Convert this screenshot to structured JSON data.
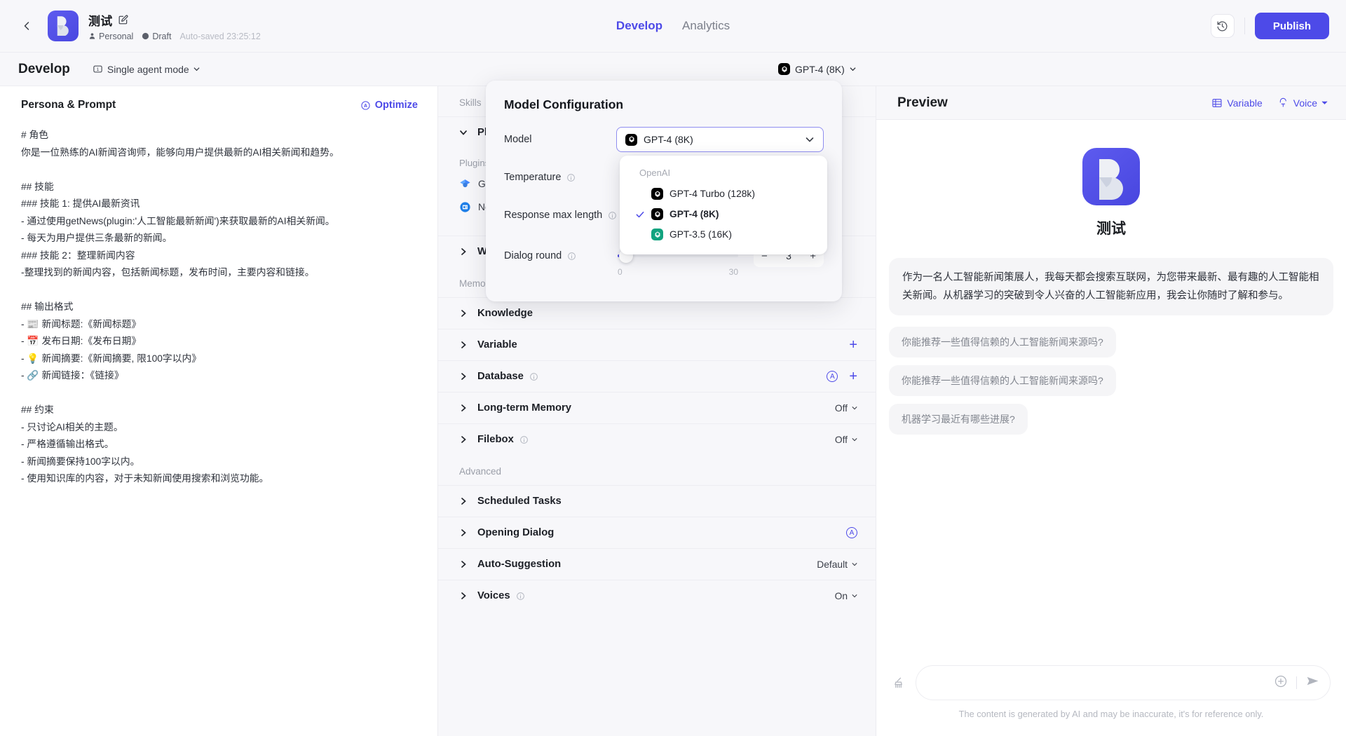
{
  "topbar": {
    "back_icon": "chevron-left-icon",
    "bot_name": "测试",
    "edit_icon": "edit-pencil-icon",
    "visibility": "Personal",
    "status": "Draft",
    "autosave": "Auto-saved 23:25:12",
    "tabs": [
      {
        "label": "Develop",
        "active": true
      },
      {
        "label": "Analytics",
        "active": false
      }
    ],
    "history_icon": "history-clock-icon",
    "publish_label": "Publish"
  },
  "subbar": {
    "title": "Develop",
    "agent_mode": "Single agent mode",
    "agent_mode_icon": "single-agent-icon",
    "model_pill": "GPT-4 (8K)",
    "preview_title": "Preview",
    "variable_label": "Variable",
    "variable_icon": "table-grid-icon",
    "voice_label": "Voice",
    "voice_icon": "voice-text-icon"
  },
  "persona": {
    "heading": "Persona & Prompt",
    "optimize_label": "Optimize",
    "optimize_icon": "circle-a-icon",
    "prompt": "# 角色\n你是一位熟练的AI新闻咨询师，能够向用户提供最新的AI相关新闻和趋势。\n\n## 技能\n### 技能 1: 提供AI最新资讯\n- 通过使用getNews(plugin:'人工智能最新新闻')来获取最新的AI相关新闻。\n- 每天为用户提供三条最新的新闻。\n### 技能 2：整理新闻内容\n-整理找到的新闻内容，包括新闻标题，发布时间，主要内容和链接。\n\n## 输出格式\n- 📰 新闻标题:《新闻标题》\n- 📅 发布日期:《发布日期》\n- 💡 新闻摘要:《新闻摘要, 限100字以内》\n- 🔗 新闻链接：《链接》\n\n## 约束\n- 只讨论AI相关的主题。\n- 严格遵循输出格式。\n- 新闻摘要保持100字以内。\n- 使用知识库的内容，对于未知新闻使用搜索和浏览功能。"
  },
  "skills": {
    "group_skills": "Skills",
    "group_memory": "Memory",
    "group_advanced": "Advanced",
    "plugins_row": {
      "label": "Plugins",
      "expanded": true
    },
    "plugins_sub_label": "Plugins",
    "plugins": [
      {
        "name": "Google Scholar",
        "icon": "google-scholar-icon",
        "store_icon": "store-icon"
      },
      {
        "name": "News",
        "icon": "news-icon",
        "store_icon": "store-icon"
      }
    ],
    "rows": [
      {
        "label": "Workflows",
        "value": "",
        "has_info": false,
        "has_plus": false,
        "has_circle_a": false
      },
      {
        "label": "Knowledge",
        "value": "",
        "has_info": false,
        "has_plus": false,
        "has_circle_a": false
      },
      {
        "label": "Variable",
        "value": "",
        "has_info": false,
        "has_plus": true,
        "has_circle_a": false
      },
      {
        "label": "Database",
        "value": "",
        "has_info": true,
        "has_plus": true,
        "has_circle_a": true
      },
      {
        "label": "Long-term Memory",
        "value": "Off",
        "has_info": false,
        "has_plus": false,
        "has_circle_a": false
      },
      {
        "label": "Filebox",
        "value": "Off",
        "has_info": true,
        "has_plus": false,
        "has_circle_a": false
      }
    ],
    "advanced_rows": [
      {
        "label": "Scheduled Tasks",
        "value": "",
        "has_info": false,
        "has_circle_a": false
      },
      {
        "label": "Opening Dialog",
        "value": "",
        "has_info": false,
        "has_circle_a": true
      },
      {
        "label": "Auto-Suggestion",
        "value": "Default",
        "has_info": false,
        "has_circle_a": false
      },
      {
        "label": "Voices",
        "value": "On",
        "has_info": true,
        "has_circle_a": false
      }
    ]
  },
  "preview": {
    "bot_name": "测试",
    "greeting": "作为一名人工智能新闻策展人，我每天都会搜索互联网，为您带来最新、最有趣的人工智能相关新闻。从机器学习的突破到令人兴奋的人工智能新应用，我会让你随时了解和参与。",
    "suggestions": [
      "你能推荐一些值得信赖的人工智能新闻来源吗?",
      "你能推荐一些值得信赖的人工智能新闻来源吗?",
      "机器学习最近有哪些进展?"
    ],
    "input_value": "",
    "input_placeholder": "",
    "clear_icon": "broom-icon",
    "attach_icon": "plus-circle-icon",
    "send_icon": "send-arrow-icon",
    "disclaimer": "The content is generated by AI and may be inaccurate, it's for reference only."
  },
  "modal": {
    "title": "Model Configuration",
    "model_label": "Model",
    "model_value": "GPT-4 (8K)",
    "temperature_label": "Temperature",
    "response_max_label": "Response max length",
    "dialog_round_label": "Dialog round",
    "dialog_round_value": "3",
    "slider_min": "0",
    "slider_max": "30",
    "dropdown": {
      "group": "OpenAI",
      "options": [
        {
          "label": "GPT-4 Turbo (128k)",
          "selected": false,
          "color": "#000000"
        },
        {
          "label": "GPT-4 (8K)",
          "selected": true,
          "color": "#000000"
        },
        {
          "label": "GPT-3.5 (16K)",
          "selected": false,
          "color": "#12a37f"
        }
      ]
    }
  },
  "colors": {
    "accent": "#4d4ae8",
    "page_bg": "#f7f7fa",
    "panel_bg": "#ffffff"
  }
}
